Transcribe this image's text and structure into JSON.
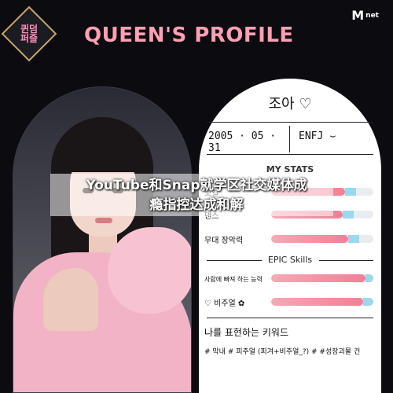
{
  "header": {
    "show_logo": "퀸덤\n퍼즐",
    "title": "QUEEN'S PROFILE",
    "broadcaster_m": "M",
    "broadcaster_net": "net"
  },
  "profile": {
    "name": "조아 ♡",
    "birthdate": "2005 · 05 · 31",
    "mbti": "ENFJ ⌣"
  },
  "stats": {
    "title": "MY STATS",
    "items": [
      {
        "label": "보컬",
        "value": 0.72
      },
      {
        "label": "댄스",
        "value": 0.7
      },
      {
        "label": "무대 장악력",
        "value": 0.75
      }
    ]
  },
  "epic_skills": {
    "title": "EPIC Skills",
    "items": [
      {
        "label": "사람에 빠져 하는 능력",
        "value": 0.92
      },
      {
        "label": "♡ 비주얼 ✿",
        "value": 0.9
      }
    ]
  },
  "keywords": {
    "title": "나를 표현하는 키워드",
    "text": "# 막내 # 피주얼 (피겨+비주얼_?) # #성장괴물 건"
  },
  "overlay": {
    "text": "YouTube和Snap就学区社交媒体成\n瘾指控达成和解"
  },
  "colors": {
    "title_pink": "#ff9fb4",
    "bar_pink": "#f27f96",
    "bar_blue": "#9ad8ee"
  }
}
